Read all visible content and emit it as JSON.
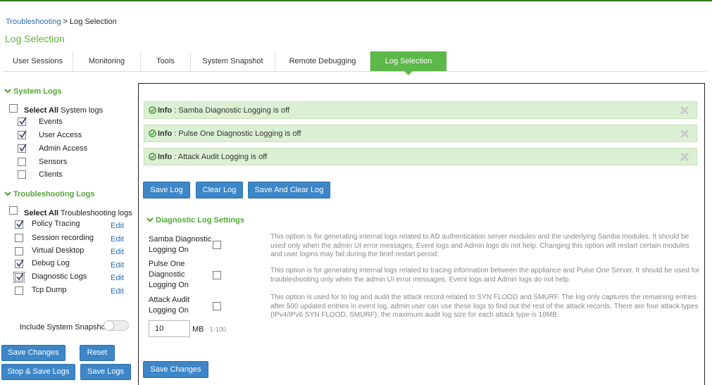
{
  "breadcrumb": {
    "parent": "Troubleshooting",
    "separator": " > ",
    "current": "Log Selection"
  },
  "page_title": "Log Selection",
  "tabs": [
    {
      "label": "User Sessions"
    },
    {
      "label": "Monitoring"
    },
    {
      "label": "Tools"
    },
    {
      "label": "System Snapshot"
    },
    {
      "label": "Remote Debugging"
    },
    {
      "label": "Log Selection",
      "active": true
    }
  ],
  "system_logs": {
    "heading": "System Logs",
    "select_all_bold": "Select All",
    "select_all_rest": " System logs",
    "items": [
      {
        "label": "Events",
        "checked": true
      },
      {
        "label": "User Access",
        "checked": true
      },
      {
        "label": "Admin Access",
        "checked": true
      },
      {
        "label": "Sensors",
        "checked": false
      },
      {
        "label": "Clients",
        "checked": false
      }
    ]
  },
  "troubleshooting_logs": {
    "heading": "Troubleshooting Logs",
    "select_all_bold": "Select All",
    "select_all_rest": " Troubleshooting logs",
    "edit_label": "Edit",
    "items": [
      {
        "label": "Policy Tracing",
        "checked": true
      },
      {
        "label": "Session recording",
        "checked": false
      },
      {
        "label": "Virtual Desktop",
        "checked": false
      },
      {
        "label": "Debug Log",
        "checked": true
      },
      {
        "label": "Diagnostic Logs",
        "checked": true
      },
      {
        "label": "Tcp Dump",
        "checked": false
      }
    ]
  },
  "include_snapshot_label": "Include System Snapshot",
  "left_buttons": {
    "save_changes": "Save Changes",
    "reset": "Reset",
    "stop_save": "Stop & Save Logs",
    "save_logs": "Save Logs"
  },
  "info_messages": [
    {
      "prefix": "Info",
      "text": ":  Samba Diagnostic Logging is off"
    },
    {
      "prefix": "Info",
      "text": ":  Pulse One Diagnostic Logging is off"
    },
    {
      "prefix": "Info",
      "text": ":  Attack Audit Logging is off"
    }
  ],
  "log_buttons": {
    "save_log": "Save Log",
    "clear_log": "Clear Log",
    "save_and_clear": "Save And Clear Log"
  },
  "diagnostic": {
    "heading": "Diagnostic Log Settings",
    "options": [
      {
        "label_lines": [
          "Samba Diagnostic",
          "Logging On"
        ],
        "description": "This option is for generating internal logs related to AD authentication server modules and the underlying Samba modules. It should be used only when the admin UI error messages, Event logs and Admin logs do not help. Changing this option will restart certain modules and user logins may fail during the brief restart period."
      },
      {
        "label_lines": [
          "Pulse One",
          "Diagnostic",
          "Logging On"
        ],
        "description": "This option is for generating internal logs related to tracing information between the appliance and Pulse One Server. It should be used for troubleshooting only when the admin UI error messages, Event logs and Admin logs do not help."
      },
      {
        "label_lines": [
          "Attack Audit",
          "Logging On"
        ],
        "description": "This option is used for to log and audit the attack record related to SYN FLOOD and SMURF. The log only captures the remaining entries after 500 updated entries in event log, admin user can use these logs to find out the rest of the attack records. There are four attack types (IPv4/IPv6 SYN FLOOD, SMURF), the maximum audit log size for each attack type is 10MB."
      }
    ],
    "size_value": "10",
    "size_unit": "MB",
    "size_range": "1-100"
  },
  "main_save_changes": "Save Changes",
  "colors": {
    "accent_green": "#5cb848",
    "button_blue": "#3d86c8",
    "link_blue": "#2a6db0",
    "info_bg": "#dcf0d4"
  }
}
